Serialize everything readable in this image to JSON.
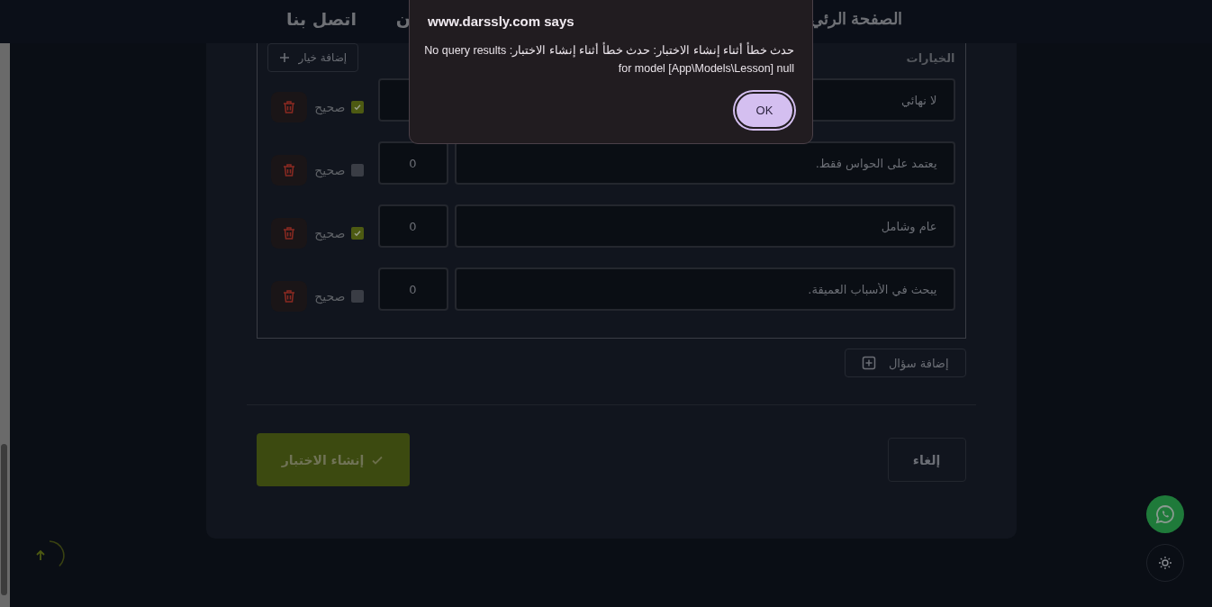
{
  "nav": {
    "items": [
      {
        "label": "الصفحة الرئي"
      },
      {
        "label": "ن"
      },
      {
        "label": "اتصل بنا"
      }
    ]
  },
  "options_section": {
    "title": "الخيارات",
    "add_button": "إضافة خيار",
    "options": [
      {
        "text": "لا نهائي",
        "correct": true,
        "correct_label": "صحيح"
      },
      {
        "text": "يعتمد على الحواس فقط.",
        "score": "0",
        "correct": false,
        "correct_label": "صحيح"
      },
      {
        "text": "عام وشامل",
        "score": "0",
        "correct": true,
        "correct_label": "صحيح"
      },
      {
        "text": "يبحث في الأسباب العميقة.",
        "score": "0",
        "correct": false,
        "correct_label": "صحيح"
      }
    ]
  },
  "add_question_button": "إضافة سؤال",
  "cancel_button": "إلغاء",
  "create_button": "إنشاء الاختبار",
  "dialog": {
    "origin": "www.darssly.com says",
    "message": "حدث خطأ أثناء إنشاء الاختبار: حدث خطأ أثناء إنشاء الاختبار:  No query results for model [App\\Models\\Lesson] null",
    "button": "OK"
  }
}
